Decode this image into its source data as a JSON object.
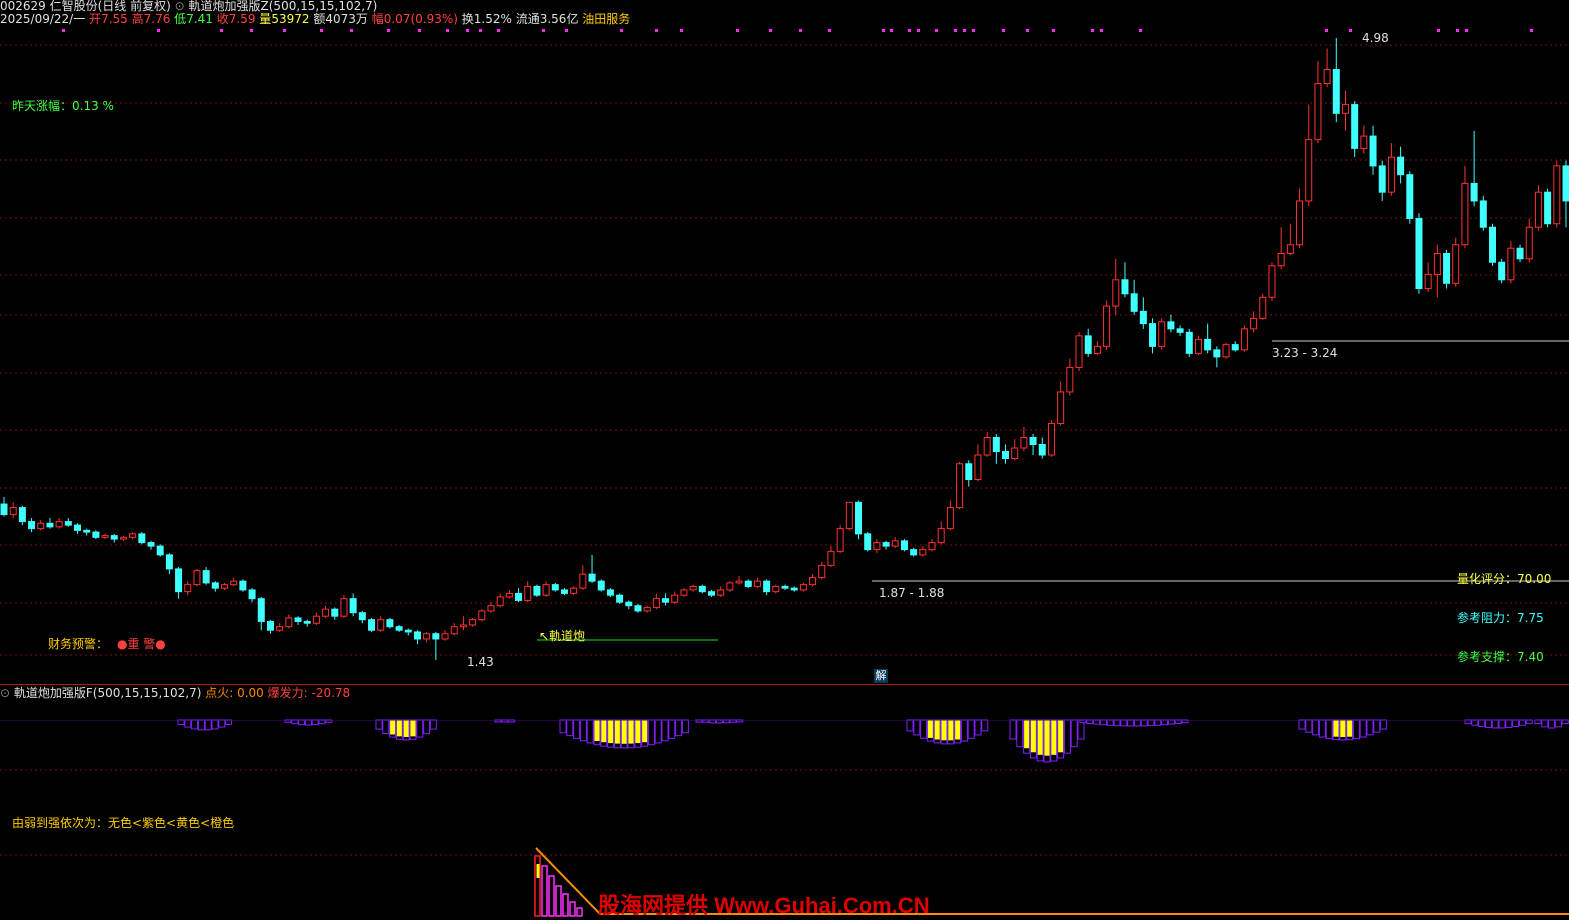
{
  "header": {
    "code_name": "002629 仁智股份(日线 前复权)",
    "indicator": "軌道炮加强版Z(500,15,15,102,7)"
  },
  "quote": {
    "date": "2025/09/22/一",
    "open_label": "开",
    "open": "7.55",
    "high_label": "高",
    "high": "7.76",
    "low_label": "低",
    "low": "7.41",
    "close_label": "收",
    "close": "7.59",
    "vol_label": "量",
    "vol": "53972",
    "amount_label": "额",
    "amount": "4073万",
    "change_label": "幅",
    "change": "0.07(0.93%)",
    "turnover": "换1.52%",
    "float": "流通3.56亿",
    "sector": "油田服务"
  },
  "left_notes": {
    "prev_change": "昨天涨幅：0.13 %",
    "finance_label": "财务预警：",
    "finance_value": "●重 警●"
  },
  "price_marks": {
    "high_mark": "4.98",
    "low_mark": "1.43",
    "zone1": "1.87 - 1.88",
    "zone2": "3.23 - 3.24",
    "signal": "↖軌道炮"
  },
  "right_panel": {
    "score": "量化评分：70.00",
    "resistance": "参考阻力：7.75",
    "support": "参考支撑：7.40"
  },
  "sub_panel": {
    "title": "軌道炮加强版F(500,15,15,102,7)",
    "ignite": "点火: 0.00",
    "burst": "爆发力: -20.78",
    "legend": "由弱到强依次为：无色<紫色<黄色<橙色",
    "jie_button": "解"
  },
  "watermark": "股海网提供 Www.Guhai.Com.CN",
  "colors": {
    "up": "#ff3030",
    "down": "#40ffff",
    "grid": "#7a1010",
    "purple": "#8020ff",
    "yellow": "#ffff00",
    "orange": "#ff8c00"
  },
  "chart_data": {
    "type": "candlestick",
    "price_range": [
      1.43,
      4.98
    ],
    "candles": [
      [
        2.32,
        2.26,
        2.36,
        2.25
      ],
      [
        2.26,
        2.3,
        2.33,
        2.24
      ],
      [
        2.3,
        2.22,
        2.31,
        2.2
      ],
      [
        2.22,
        2.18,
        2.24,
        2.16
      ],
      [
        2.18,
        2.21,
        2.23,
        2.17
      ],
      [
        2.21,
        2.19,
        2.24,
        2.18
      ],
      [
        2.19,
        2.22,
        2.24,
        2.18
      ],
      [
        2.22,
        2.2,
        2.24,
        2.19
      ],
      [
        2.2,
        2.17,
        2.21,
        2.15
      ],
      [
        2.17,
        2.16,
        2.18,
        2.14
      ],
      [
        2.16,
        2.13,
        2.17,
        2.12
      ],
      [
        2.13,
        2.14,
        2.15,
        2.12
      ],
      [
        2.14,
        2.12,
        2.15,
        2.1
      ],
      [
        2.12,
        2.13,
        2.14,
        2.11
      ],
      [
        2.13,
        2.15,
        2.16,
        2.12
      ],
      [
        2.15,
        2.1,
        2.16,
        2.09
      ],
      [
        2.1,
        2.08,
        2.11,
        2.06
      ],
      [
        2.08,
        2.03,
        2.09,
        2.02
      ],
      [
        2.03,
        1.95,
        2.04,
        1.92
      ],
      [
        1.95,
        1.82,
        1.96,
        1.78
      ],
      [
        1.82,
        1.86,
        1.88,
        1.8
      ],
      [
        1.86,
        1.94,
        1.95,
        1.85
      ],
      [
        1.94,
        1.87,
        1.96,
        1.86
      ],
      [
        1.87,
        1.84,
        1.88,
        1.82
      ],
      [
        1.84,
        1.86,
        1.87,
        1.83
      ],
      [
        1.86,
        1.88,
        1.9,
        1.85
      ],
      [
        1.88,
        1.83,
        1.89,
        1.82
      ],
      [
        1.83,
        1.78,
        1.84,
        1.76
      ],
      [
        1.78,
        1.65,
        1.79,
        1.6
      ],
      [
        1.65,
        1.6,
        1.66,
        1.58
      ],
      [
        1.6,
        1.62,
        1.64,
        1.59
      ],
      [
        1.62,
        1.67,
        1.69,
        1.61
      ],
      [
        1.67,
        1.65,
        1.68,
        1.63
      ],
      [
        1.65,
        1.64,
        1.66,
        1.62
      ],
      [
        1.64,
        1.68,
        1.7,
        1.63
      ],
      [
        1.68,
        1.72,
        1.74,
        1.67
      ],
      [
        1.72,
        1.68,
        1.73,
        1.66
      ],
      [
        1.68,
        1.78,
        1.8,
        1.67
      ],
      [
        1.78,
        1.7,
        1.81,
        1.68
      ],
      [
        1.7,
        1.66,
        1.71,
        1.64
      ],
      [
        1.66,
        1.6,
        1.67,
        1.59
      ],
      [
        1.6,
        1.66,
        1.68,
        1.59
      ],
      [
        1.66,
        1.62,
        1.67,
        1.61
      ],
      [
        1.62,
        1.6,
        1.63,
        1.59
      ],
      [
        1.6,
        1.59,
        1.61,
        1.57
      ],
      [
        1.59,
        1.55,
        1.6,
        1.52
      ],
      [
        1.55,
        1.58,
        1.59,
        1.53
      ],
      [
        1.58,
        1.55,
        1.59,
        1.43
      ],
      [
        1.55,
        1.58,
        1.6,
        1.54
      ],
      [
        1.58,
        1.62,
        1.64,
        1.57
      ],
      [
        1.62,
        1.63,
        1.68,
        1.6
      ],
      [
        1.63,
        1.66,
        1.67,
        1.62
      ],
      [
        1.66,
        1.71,
        1.72,
        1.65
      ],
      [
        1.71,
        1.74,
        1.76,
        1.7
      ],
      [
        1.74,
        1.79,
        1.81,
        1.73
      ],
      [
        1.79,
        1.81,
        1.83,
        1.78
      ],
      [
        1.81,
        1.77,
        1.84,
        1.76
      ],
      [
        1.77,
        1.85,
        1.88,
        1.76
      ],
      [
        1.85,
        1.8,
        1.86,
        1.79
      ],
      [
        1.8,
        1.86,
        1.88,
        1.79
      ],
      [
        1.86,
        1.83,
        1.87,
        1.82
      ],
      [
        1.83,
        1.81,
        1.84,
        1.8
      ],
      [
        1.81,
        1.84,
        1.85,
        1.8
      ],
      [
        1.84,
        1.92,
        1.97,
        1.83
      ],
      [
        1.92,
        1.88,
        2.03,
        1.87
      ],
      [
        1.88,
        1.83,
        1.89,
        1.82
      ],
      [
        1.83,
        1.8,
        1.84,
        1.79
      ],
      [
        1.8,
        1.76,
        1.81,
        1.75
      ],
      [
        1.76,
        1.74,
        1.77,
        1.72
      ],
      [
        1.74,
        1.71,
        1.75,
        1.7
      ],
      [
        1.71,
        1.73,
        1.74,
        1.7
      ],
      [
        1.73,
        1.78,
        1.81,
        1.72
      ],
      [
        1.78,
        1.76,
        1.81,
        1.74
      ],
      [
        1.76,
        1.8,
        1.82,
        1.75
      ],
      [
        1.8,
        1.83,
        1.84,
        1.79
      ],
      [
        1.83,
        1.85,
        1.86,
        1.82
      ],
      [
        1.85,
        1.82,
        1.86,
        1.81
      ],
      [
        1.82,
        1.8,
        1.83,
        1.79
      ],
      [
        1.8,
        1.83,
        1.85,
        1.79
      ],
      [
        1.83,
        1.87,
        1.88,
        1.82
      ],
      [
        1.87,
        1.88,
        1.91,
        1.86
      ],
      [
        1.88,
        1.85,
        1.89,
        1.84
      ],
      [
        1.85,
        1.88,
        1.9,
        1.84
      ],
      [
        1.88,
        1.82,
        1.89,
        1.8
      ],
      [
        1.82,
        1.85,
        1.86,
        1.81
      ],
      [
        1.85,
        1.84,
        1.86,
        1.83
      ],
      [
        1.84,
        1.83,
        1.85,
        1.82
      ],
      [
        1.83,
        1.86,
        1.87,
        1.82
      ],
      [
        1.86,
        1.9,
        1.92,
        1.85
      ],
      [
        1.9,
        1.97,
        1.99,
        1.89
      ],
      [
        1.97,
        2.05,
        2.08,
        1.96
      ],
      [
        2.05,
        2.18,
        2.2,
        2.04
      ],
      [
        2.18,
        2.33,
        2.33,
        2.17
      ],
      [
        2.33,
        2.15,
        2.34,
        2.12
      ],
      [
        2.15,
        2.06,
        2.16,
        2.05
      ],
      [
        2.06,
        2.1,
        2.12,
        2.04
      ],
      [
        2.1,
        2.08,
        2.11,
        2.06
      ],
      [
        2.08,
        2.11,
        2.13,
        2.07
      ],
      [
        2.11,
        2.06,
        2.12,
        2.05
      ],
      [
        2.06,
        2.03,
        2.07,
        2.02
      ],
      [
        2.03,
        2.06,
        2.08,
        2.02
      ],
      [
        2.06,
        2.1,
        2.12,
        2.05
      ],
      [
        2.1,
        2.18,
        2.22,
        2.09
      ],
      [
        2.18,
        2.3,
        2.34,
        2.17
      ],
      [
        2.3,
        2.55,
        2.56,
        2.29
      ],
      [
        2.55,
        2.46,
        2.57,
        2.42
      ],
      [
        2.46,
        2.6,
        2.66,
        2.45
      ],
      [
        2.6,
        2.7,
        2.73,
        2.59
      ],
      [
        2.7,
        2.62,
        2.72,
        2.55
      ],
      [
        2.62,
        2.58,
        2.66,
        2.55
      ],
      [
        2.58,
        2.64,
        2.69,
        2.57
      ],
      [
        2.64,
        2.7,
        2.76,
        2.62
      ],
      [
        2.7,
        2.66,
        2.72,
        2.6
      ],
      [
        2.66,
        2.6,
        2.7,
        2.58
      ],
      [
        2.6,
        2.78,
        2.8,
        2.59
      ],
      [
        2.78,
        2.96,
        3.02,
        2.77
      ],
      [
        2.96,
        3.1,
        3.15,
        2.94
      ],
      [
        3.1,
        3.28,
        3.3,
        3.08
      ],
      [
        3.28,
        3.18,
        3.32,
        3.16
      ],
      [
        3.18,
        3.22,
        3.25,
        3.17
      ],
      [
        3.22,
        3.45,
        3.48,
        3.2
      ],
      [
        3.45,
        3.6,
        3.72,
        3.4
      ],
      [
        3.6,
        3.52,
        3.7,
        3.5
      ],
      [
        3.52,
        3.42,
        3.6,
        3.4
      ],
      [
        3.42,
        3.35,
        3.5,
        3.32
      ],
      [
        3.35,
        3.22,
        3.38,
        3.18
      ],
      [
        3.22,
        3.36,
        3.38,
        3.2
      ],
      [
        3.36,
        3.32,
        3.4,
        3.3
      ],
      [
        3.32,
        3.3,
        3.34,
        3.28
      ],
      [
        3.3,
        3.18,
        3.32,
        3.16
      ],
      [
        3.18,
        3.26,
        3.28,
        3.17
      ],
      [
        3.26,
        3.2,
        3.35,
        3.18
      ],
      [
        3.2,
        3.16,
        3.22,
        3.1
      ],
      [
        3.16,
        3.23,
        3.24,
        3.15
      ],
      [
        3.23,
        3.2,
        3.25,
        3.19
      ],
      [
        3.2,
        3.32,
        3.34,
        3.19
      ],
      [
        3.32,
        3.38,
        3.42,
        3.3
      ],
      [
        3.38,
        3.5,
        3.52,
        3.37
      ],
      [
        3.5,
        3.68,
        3.7,
        3.48
      ],
      [
        3.68,
        3.75,
        3.9,
        3.66
      ],
      [
        3.75,
        3.8,
        3.92,
        3.74
      ],
      [
        3.8,
        4.05,
        4.12,
        3.78
      ],
      [
        4.05,
        4.4,
        4.6,
        4.02
      ],
      [
        4.4,
        4.72,
        4.85,
        4.38
      ],
      [
        4.72,
        4.8,
        4.92,
        4.7
      ],
      [
        4.8,
        4.55,
        4.98,
        4.5
      ],
      [
        4.55,
        4.6,
        4.68,
        4.45
      ],
      [
        4.6,
        4.35,
        4.62,
        4.3
      ],
      [
        4.35,
        4.42,
        4.48,
        4.32
      ],
      [
        4.42,
        4.25,
        4.48,
        4.2
      ],
      [
        4.25,
        4.1,
        4.28,
        4.05
      ],
      [
        4.1,
        4.3,
        4.38,
        4.08
      ],
      [
        4.3,
        4.2,
        4.36,
        4.15
      ],
      [
        4.2,
        3.95,
        4.22,
        3.92
      ],
      [
        3.95,
        3.55,
        3.98,
        3.52
      ],
      [
        3.55,
        3.63,
        3.7,
        3.53
      ],
      [
        3.63,
        3.75,
        3.8,
        3.5
      ],
      [
        3.75,
        3.58,
        3.77,
        3.55
      ],
      [
        3.58,
        3.8,
        3.84,
        3.56
      ],
      [
        3.8,
        4.15,
        4.25,
        3.78
      ],
      [
        4.15,
        4.05,
        4.45,
        4.02
      ],
      [
        4.05,
        3.9,
        4.08,
        3.88
      ],
      [
        3.9,
        3.7,
        3.92,
        3.68
      ],
      [
        3.7,
        3.6,
        3.72,
        3.58
      ],
      [
        3.6,
        3.78,
        3.82,
        3.58
      ],
      [
        3.78,
        3.72,
        3.8,
        3.7
      ],
      [
        3.72,
        3.9,
        3.95,
        3.7
      ],
      [
        3.9,
        4.1,
        4.14,
        3.88
      ],
      [
        4.1,
        3.92,
        4.12,
        3.9
      ],
      [
        3.92,
        4.25,
        4.28,
        3.9
      ],
      [
        4.25,
        4.05,
        4.28,
        3.9
      ]
    ]
  }
}
